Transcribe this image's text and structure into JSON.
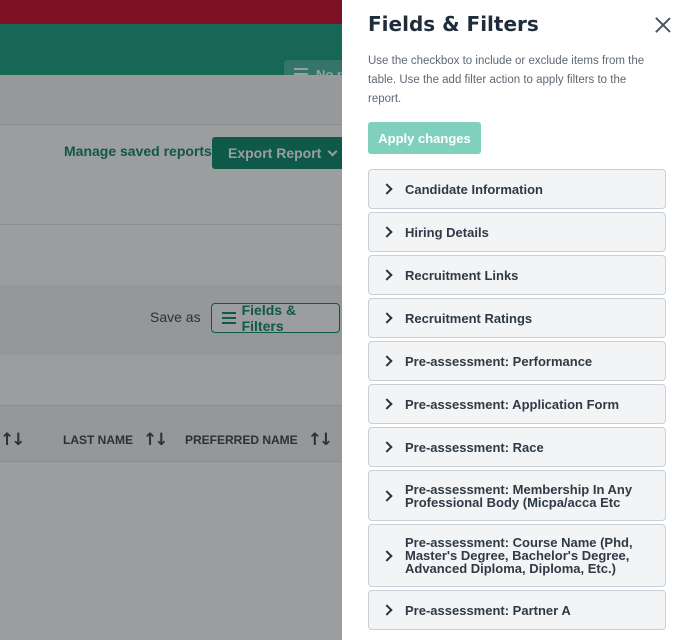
{
  "background": {
    "chip_label": "No p",
    "manage_saved_reports": "Manage saved reports",
    "export_report": "Export Report",
    "save_as": "Save as",
    "fields_filters_button": "Fields & Filters",
    "columns": [
      "LAST NAME",
      "PREFERRED NAME"
    ],
    "colors": {
      "brand_red": "#c8102e",
      "brand_green": "#1aa385",
      "primary": "#0d8a6c"
    }
  },
  "drawer": {
    "title": "Fields & Filters",
    "description": "Use the checkbox to include or exclude items from the table. Use the add filter action to apply filters to the report.",
    "apply_label": "Apply changes",
    "sections": [
      "Candidate Information",
      "Hiring Details",
      "Recruitment Links",
      "Recruitment Ratings",
      "Pre-assessment: Performance",
      "Pre-assessment: Application Form",
      "Pre-assessment: Race",
      "Pre-assessment: Membership In Any Professional Body (Micpa/acca Etc",
      "Pre-assessment: Course Name (Phd, Master's Degree, Bachelor's Degree, Advanced Diploma, Diploma, Etc.)",
      "Pre-assessment: Partner A"
    ]
  }
}
